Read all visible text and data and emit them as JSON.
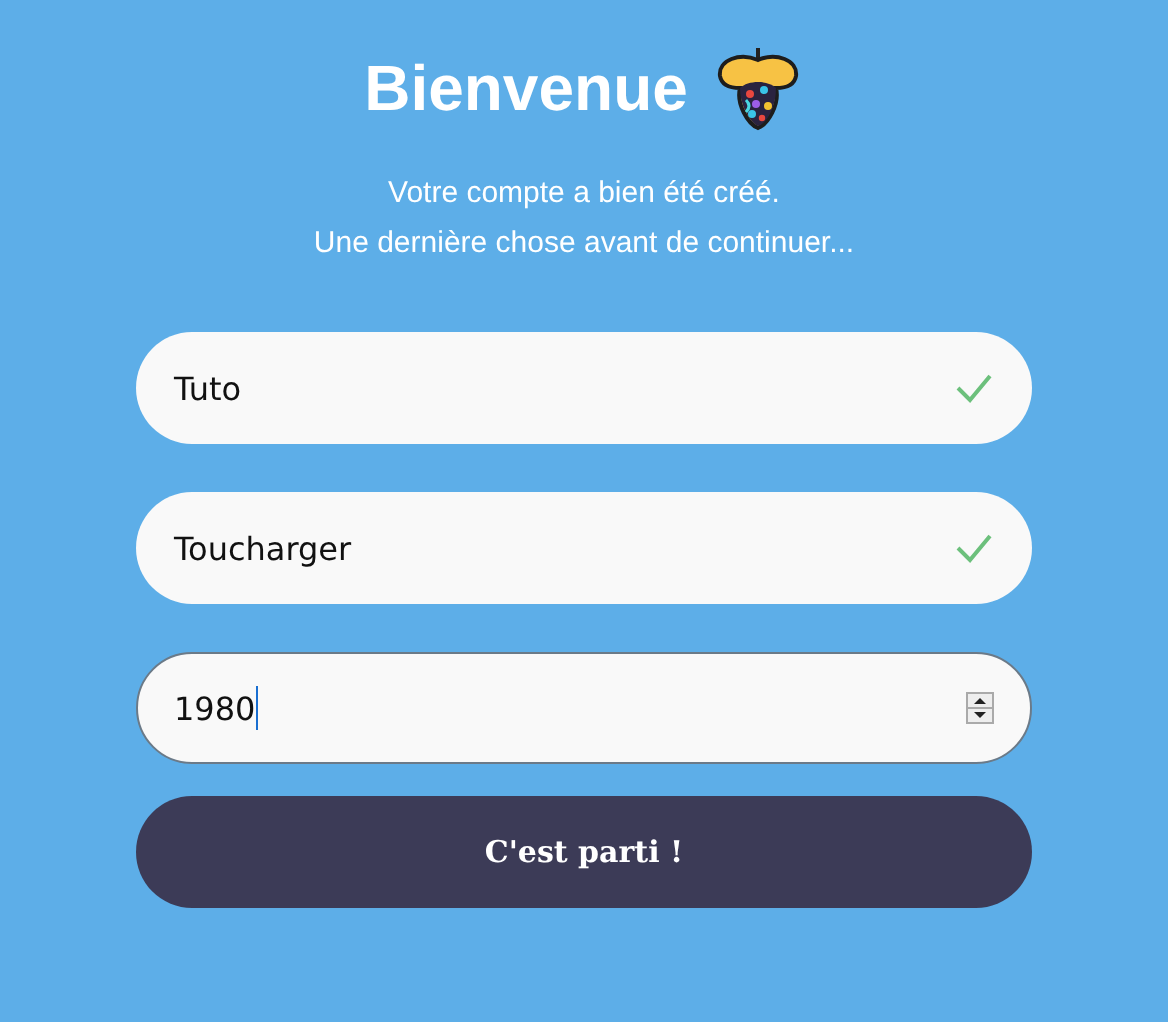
{
  "title": "Bienvenue",
  "subtitle_lines": [
    "Votre compte a bien été créé.",
    "Une dernière chose avant de continuer..."
  ],
  "fields": [
    {
      "kind": "text",
      "value": "Tuto",
      "valid": true,
      "focused": false
    },
    {
      "kind": "text",
      "value": "Toucharger",
      "valid": true,
      "focused": false
    },
    {
      "kind": "number",
      "value": "1980",
      "valid": false,
      "focused": true
    }
  ],
  "submit_button": "C'est parti !"
}
